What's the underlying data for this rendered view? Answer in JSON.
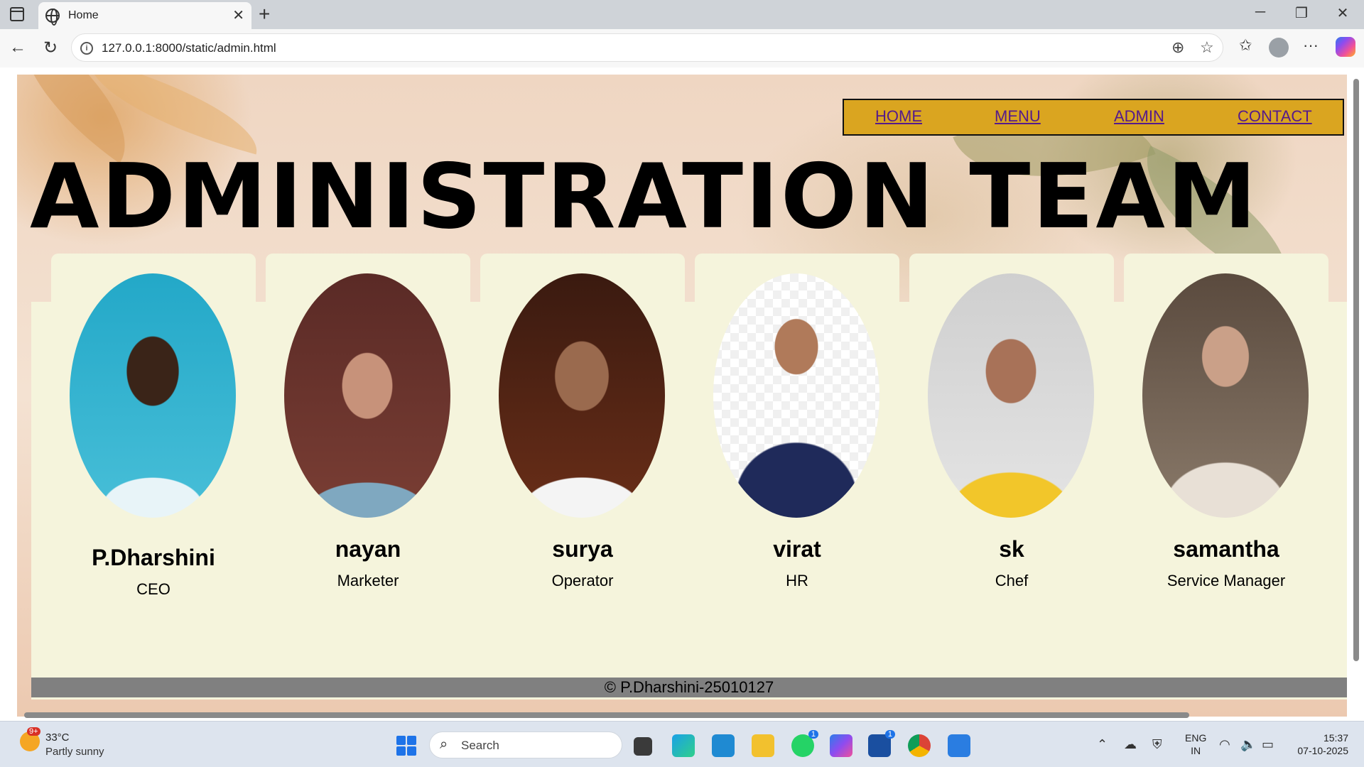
{
  "browser": {
    "tab_title": "Home",
    "url": "127.0.0.1:8000/static/admin.html"
  },
  "nav": {
    "links": [
      "HOME",
      "MENU",
      "ADMIN",
      "CONTACT"
    ]
  },
  "page": {
    "headline": "ADMINISTRATION TEAM",
    "footer": "© P.Dharshini-25010127"
  },
  "team": [
    {
      "name": "P.Dharshini",
      "role": "CEO"
    },
    {
      "name": "nayan",
      "role": "Marketer"
    },
    {
      "name": "surya",
      "role": "Operator"
    },
    {
      "name": "virat",
      "role": "HR"
    },
    {
      "name": "sk",
      "role": "Chef"
    },
    {
      "name": "samantha",
      "role": "Service Manager"
    }
  ],
  "taskbar": {
    "weather_temp": "33°C",
    "weather_cond": "Partly sunny",
    "weather_badge": "9+",
    "search_placeholder": "Search",
    "whatsapp_badge": "1",
    "store_badge": "1",
    "lang_line1": "ENG",
    "lang_line2": "IN",
    "time": "15:37",
    "date": "07-10-2025"
  },
  "colors": {
    "nav_bg": "#daa520",
    "card_bg": "#f5f4dc",
    "footer_bg": "#808080",
    "link": "#551a8b"
  }
}
